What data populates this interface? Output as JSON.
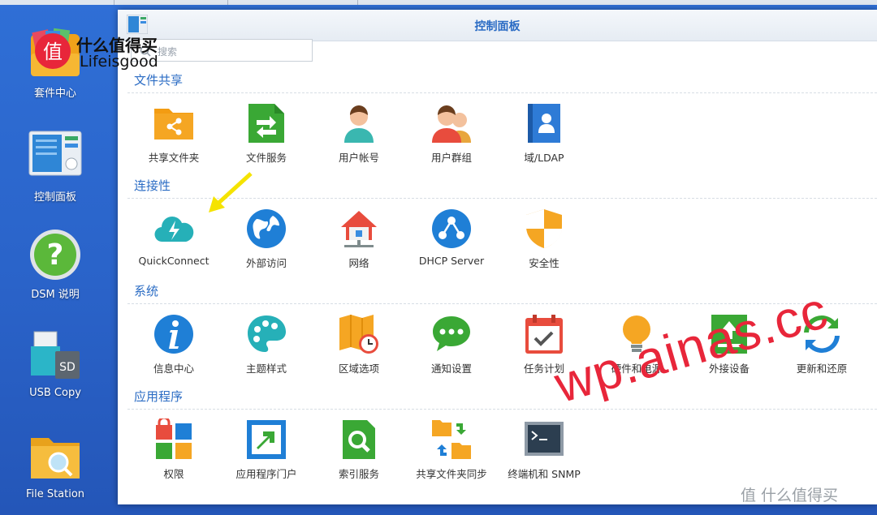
{
  "window": {
    "title": "控制面板"
  },
  "search": {
    "placeholder": "搜索"
  },
  "desktop": {
    "icons": [
      {
        "label": "套件中心"
      },
      {
        "label": "控制面板"
      },
      {
        "label": "DSM 说明"
      },
      {
        "label": "USB Copy"
      },
      {
        "label": "File Station"
      }
    ]
  },
  "sections": [
    {
      "title": "文件共享",
      "items": [
        "共享文件夹",
        "文件服务",
        "用户帐号",
        "用户群组",
        "域/LDAP"
      ]
    },
    {
      "title": "连接性",
      "items": [
        "QuickConnect",
        "外部访问",
        "网络",
        "DHCP Server",
        "安全性"
      ]
    },
    {
      "title": "系统",
      "items": [
        "信息中心",
        "主题样式",
        "区域选项",
        "通知设置",
        "任务计划",
        "硬件和电源",
        "外接设备",
        "更新和还原"
      ]
    },
    {
      "title": "应用程序",
      "items": [
        "权限",
        "应用程序门户",
        "索引服务",
        "共享文件夹同步",
        "终端机和 SNMP"
      ]
    }
  ],
  "overlay": {
    "logo_line1": "什么值得买",
    "logo_line2": "Lifeisgood",
    "logo_badge": "值",
    "watermark": "wp.ainas.cc",
    "bottom_watermark": "值 什么值得买"
  },
  "colors": {
    "accent": "#2b6cc4",
    "desktop_bg": "#2a63c9",
    "watermark": "#e8263a"
  }
}
